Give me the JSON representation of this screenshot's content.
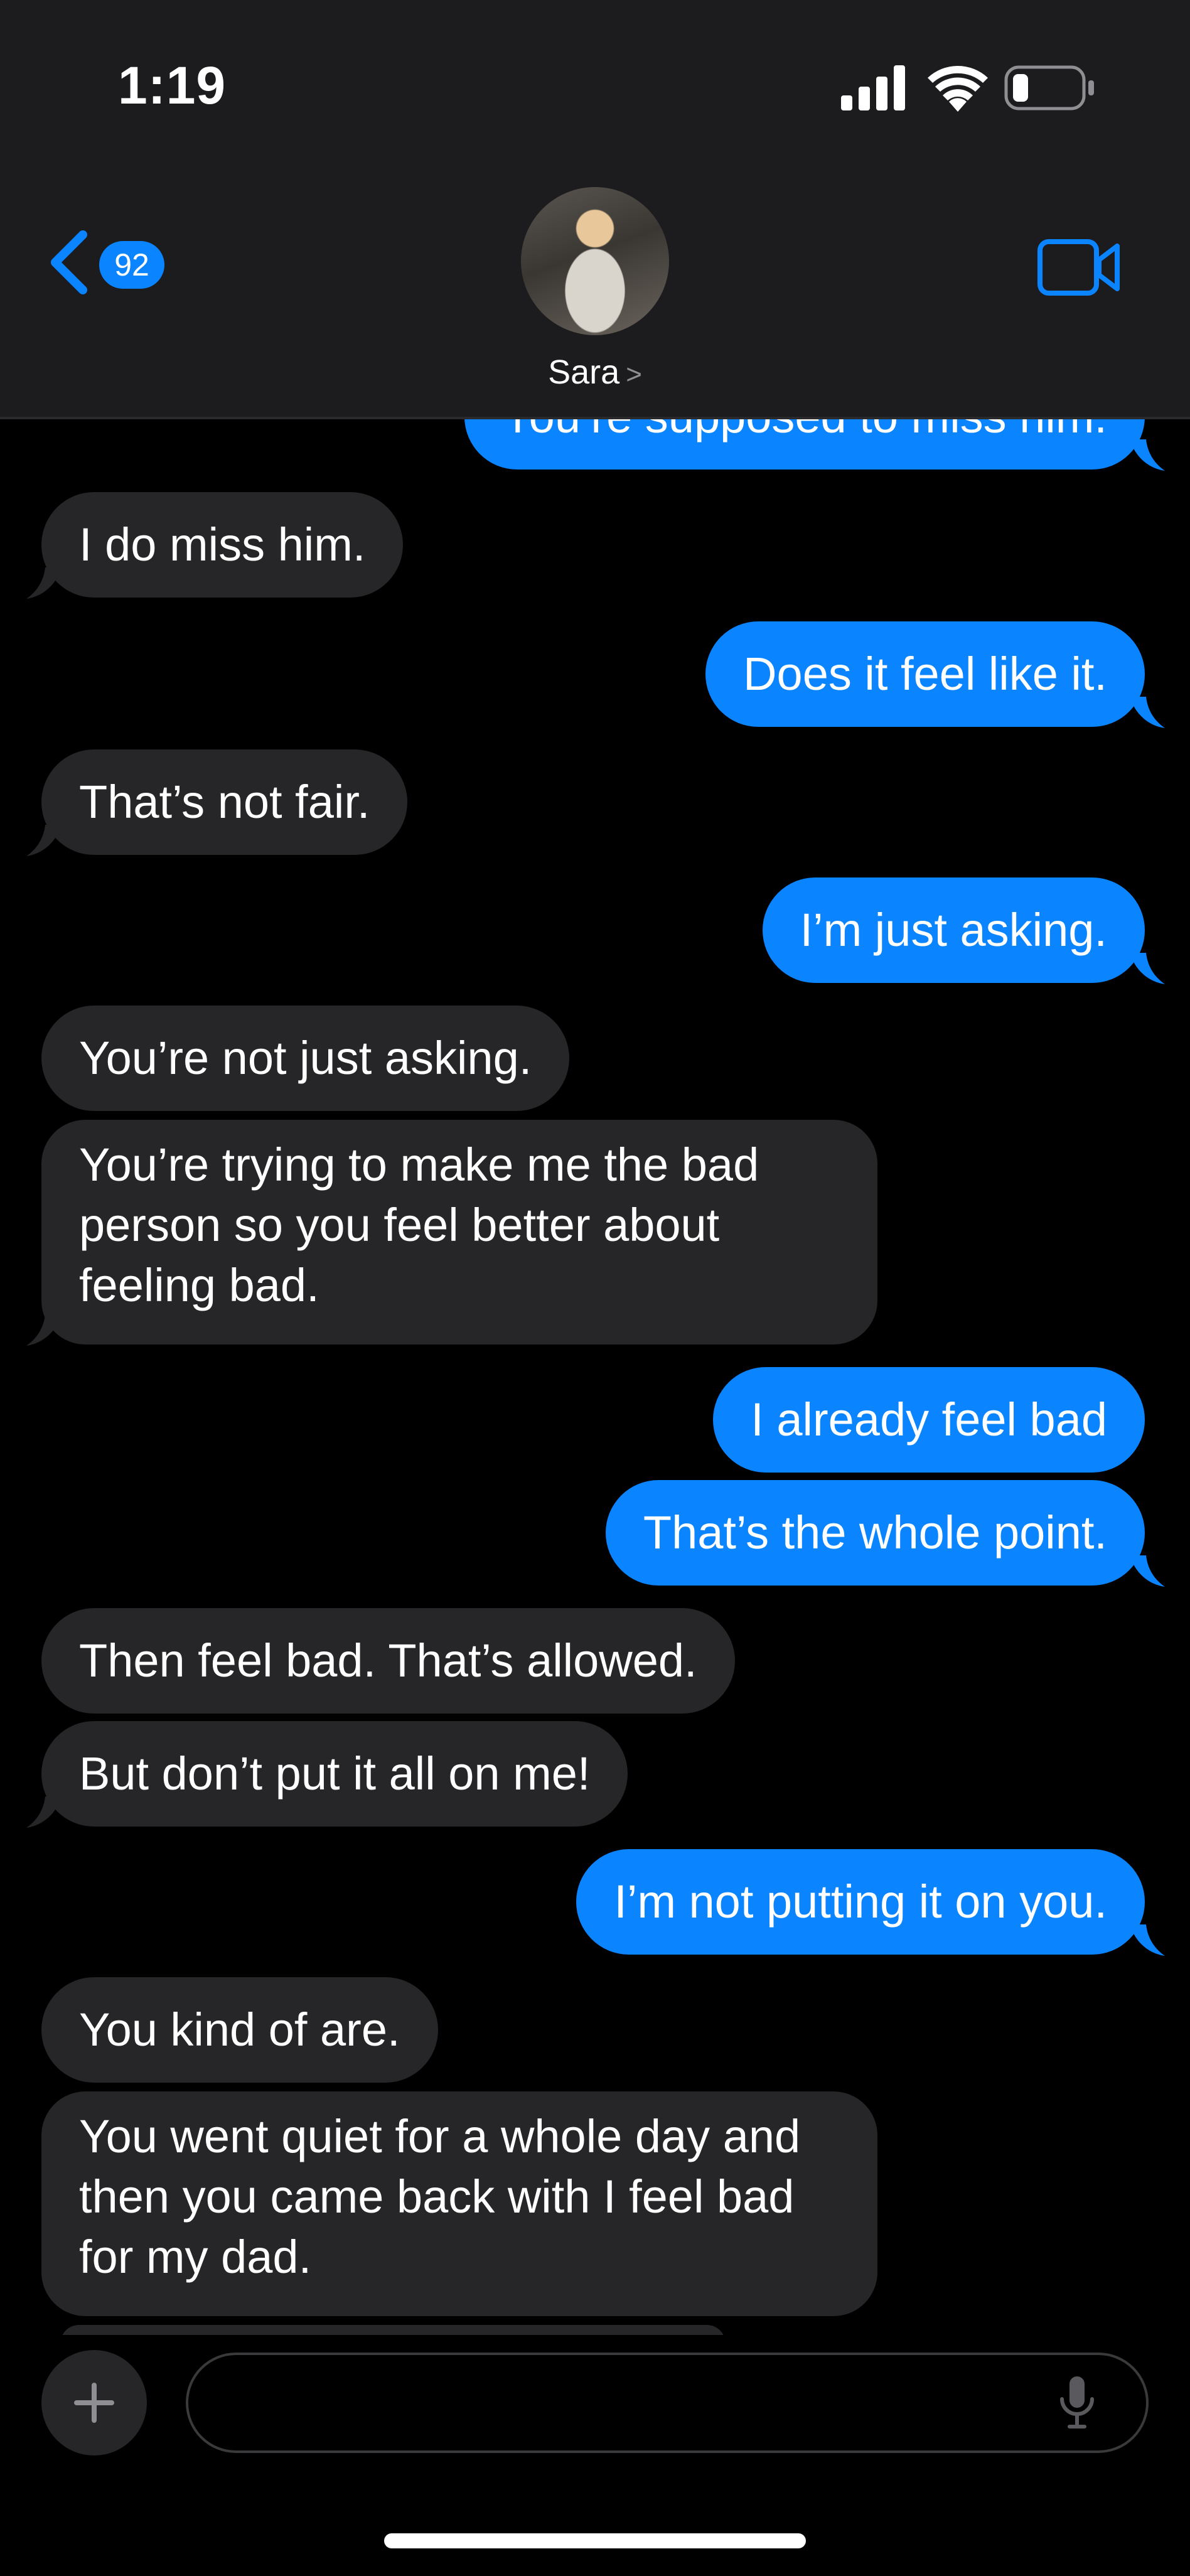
{
  "status_bar": {
    "time": "1:19"
  },
  "header": {
    "back_badge_count": "92",
    "contact_name": "Sara",
    "contact_chevron": ">"
  },
  "messages": [
    {
      "direction": "sent",
      "text": "You’re supposed to miss him."
    },
    {
      "direction": "received",
      "text": "I do miss him."
    },
    {
      "direction": "sent",
      "text": "Does it feel like it."
    },
    {
      "direction": "received",
      "text": "That’s not fair."
    },
    {
      "direction": "sent",
      "text": "I’m just asking."
    },
    {
      "direction": "received",
      "text": "You’re not just asking."
    },
    {
      "direction": "received",
      "text": "You’re trying to make me the bad person so you feel better about feeling bad."
    },
    {
      "direction": "sent",
      "text": "I already feel bad"
    },
    {
      "direction": "sent",
      "text": "That’s the whole point."
    },
    {
      "direction": "received",
      "text": "Then feel bad. That’s allowed."
    },
    {
      "direction": "received",
      "text": "But don’t put it all on me!"
    },
    {
      "direction": "sent",
      "text": "I’m not putting it on you."
    },
    {
      "direction": "received",
      "text": "You kind of are."
    },
    {
      "direction": "received",
      "text": "You went quiet for a whole day and then you came back with I feel bad for my dad."
    }
  ],
  "input": {
    "placeholder": ""
  },
  "colors": {
    "sent_bubble": "#0a84ff",
    "received_bubble": "#262628",
    "header_bg": "#1c1c1e"
  },
  "icons": [
    "signal-icon",
    "wifi-icon",
    "battery-icon",
    "back-chevron-icon",
    "video-camera-icon",
    "plus-icon",
    "microphone-icon"
  ]
}
